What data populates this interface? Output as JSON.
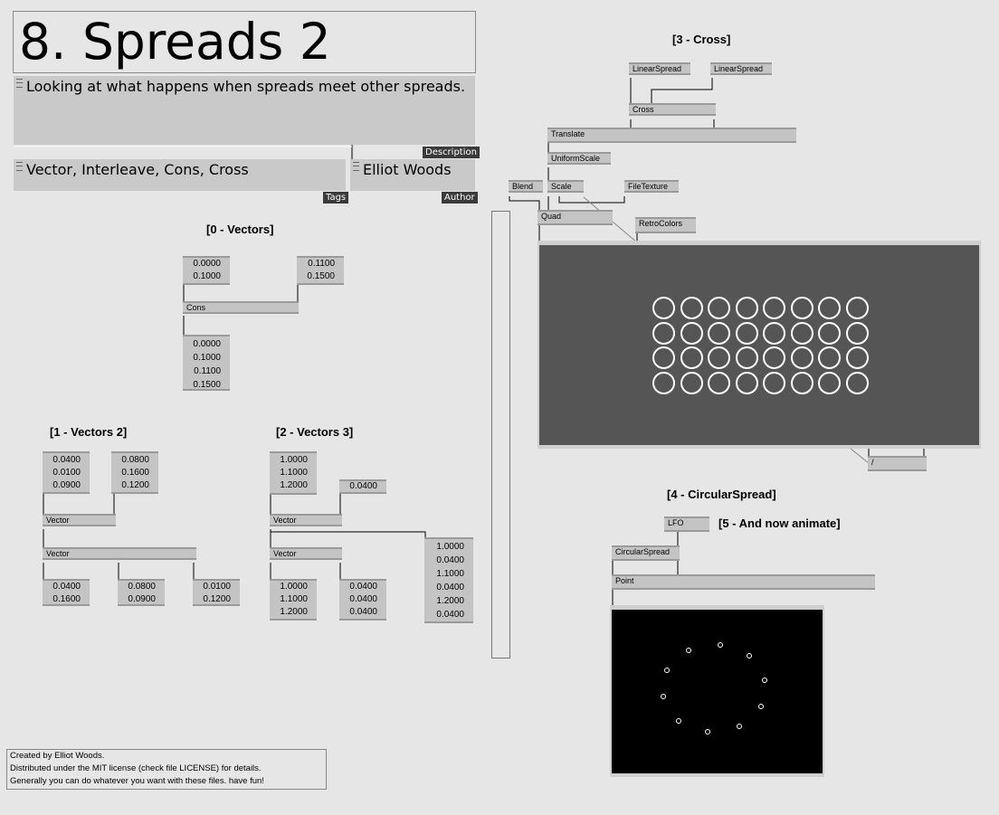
{
  "title": "8. Spreads 2",
  "description": "Looking at what happens when spreads meet other spreads.",
  "description_tag": "Description",
  "tags": "Vector, Interleave, Cons, Cross",
  "tags_tag": "Tags",
  "author": "Elliot Woods",
  "author_tag": "Author",
  "sections": {
    "vectors": "[0 - Vectors]",
    "vectors2": "[1 - Vectors 2]",
    "vectors3": "[2 - Vectors 3]",
    "cross": "[3 - Cross]",
    "circular": "[4 - CircularSpread]",
    "animate": "[5 - And now animate]"
  },
  "nodes": {
    "cons": "Cons",
    "vector": "Vector",
    "linear_spread": "LinearSpread",
    "cross": "Cross",
    "translate": "Translate",
    "uniform_scale": "UniformScale",
    "blend": "Blend",
    "scale": "Scale",
    "file_texture": "FileTexture",
    "quad": "Quad",
    "retro_colors": "RetroColors",
    "divide": "/",
    "lfo": "LFO",
    "circular_spread": "CircularSpread",
    "point": "Point"
  },
  "values": {
    "v0_in_a": [
      "0.0000",
      "0.1000"
    ],
    "v0_in_b": [
      "0.1100",
      "0.1500"
    ],
    "v0_out": [
      "0.0000",
      "0.1000",
      "0.1100",
      "0.1500"
    ],
    "v1_in_a": [
      "0.0400",
      "0.0100",
      "0.0900"
    ],
    "v1_in_b": [
      "0.0800",
      "0.1600",
      "0.1200"
    ],
    "v1_out_a": [
      "0.0400",
      "0.1600"
    ],
    "v1_out_b": [
      "0.0800",
      "0.0900"
    ],
    "v1_out_c": [
      "0.0100",
      "0.1200"
    ],
    "v2_in_a": [
      "1.0000",
      "1.1000",
      "1.2000"
    ],
    "v2_in_b": [
      "0.0400"
    ],
    "v2_out_a": [
      "1.0000",
      "1.1000",
      "1.2000"
    ],
    "v2_out_b": [
      "0.0400",
      "0.0400",
      "0.0400"
    ],
    "v2_out_c": [
      "1.0000",
      "0.0400",
      "1.1000",
      "0.0400",
      "1.2000",
      "0.0400"
    ]
  },
  "footer": [
    "Created by Elliot Woods.",
    "Distributed under the MIT license (check file LICENSE) for details.",
    "Generally you can do whatever you want with these files. have fun!"
  ],
  "colors": {
    "background": "#e6e6e6",
    "node": "#c4c4c4",
    "renderer_grey": "#555555",
    "renderer_black": "#000000",
    "tag_bg": "#3a3a3a"
  }
}
